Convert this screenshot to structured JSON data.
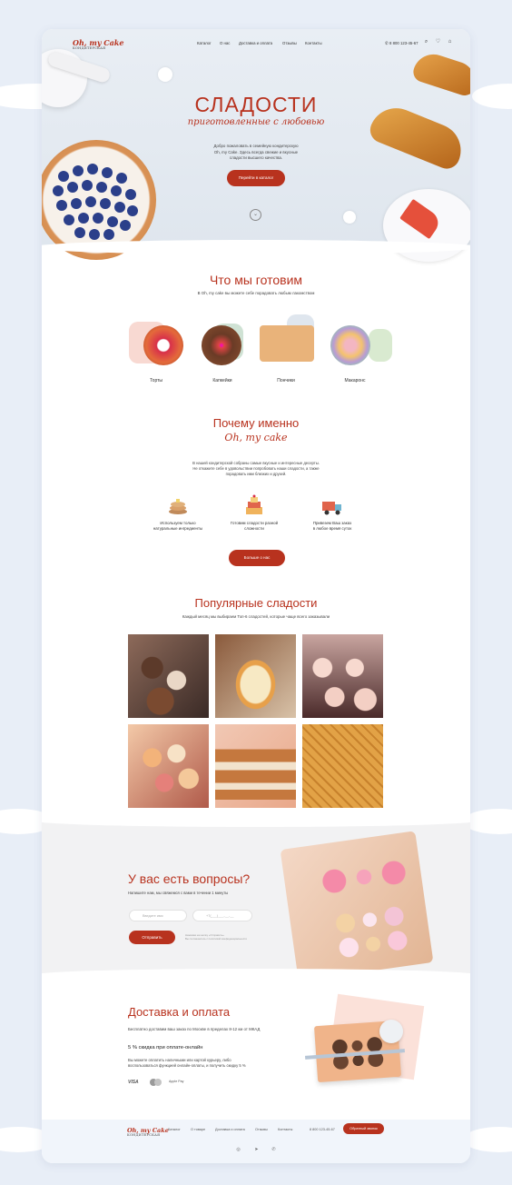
{
  "brand": {
    "logo": "Oh, my Cake",
    "tagline": "КОНДИТЕРСКАЯ"
  },
  "nav": {
    "items": [
      "Каталог",
      "О нас",
      "Доставка и оплата",
      "Отзывы",
      "Контакты"
    ],
    "phone": "8 800 123-45-67"
  },
  "hero": {
    "title": "СЛАДОСТИ",
    "script": "приготовленные с любовью",
    "text_lines": [
      "Добро пожаловать в семейную кондитерскую",
      "Oh, my Cake. Здесь всегда свежие и вкусные",
      "сладости высшего качества."
    ],
    "button": "Перейти в каталог"
  },
  "what": {
    "title": "Что мы готовим",
    "subtitle": "В Oh, my cake вы можете себе порадовать любым лакомством",
    "items": [
      "Торты",
      "Капкейки",
      "Пончики",
      "Макаронс"
    ]
  },
  "why": {
    "title": "Почему именно",
    "script": "Oh, my cake",
    "text_lines": [
      "В нашей кондитерской собраны самые вкусные и интересные десерты.",
      "Не откажите себе в удовольствии попробовать наши сладости, а также",
      "порадовать ими близких и друзей."
    ],
    "features": [
      {
        "l1": "Используем только",
        "l2": "натуральные ингредиенты"
      },
      {
        "l1": "Готовим сладости разной",
        "l2": "сложности"
      },
      {
        "l1": "Привезем Ваш заказ",
        "l2": "в любое время суток"
      }
    ],
    "button": "Больше о нас"
  },
  "popular": {
    "title": "Популярные сладости",
    "subtitle": "Каждый месяц мы выбираем Топ-6 сладостей, которые чаще всего заказывали"
  },
  "questions": {
    "title": "У вас есть вопросы?",
    "subtitle": "Напишите нам, мы свяжемся с вами в течении 1 минуты",
    "name_placeholder": "Введите имя",
    "phone_placeholder": "+7(___)___-__-__",
    "button": "Отправить",
    "consent_l1": "Нажимая на кнопку «Отправить»",
    "consent_l2": "Вы соглашаетесь с политикой конфиденциальности"
  },
  "delivery": {
    "title": "Доставка и оплата",
    "text": "Бесплатно доставим ваш заказ по Москве в пределах 8-12 км от МКАД",
    "discount": "5 % скидка при оплате-онлайн",
    "text2_l1": "Вы можете оплатить наличными или картой курьеру, либо",
    "text2_l2": "воспользоваться функцией онлайн-оплаты, и получить скидку 5 %",
    "pay": [
      "VISA",
      "mastercard",
      "Apple Pay"
    ]
  },
  "footer": {
    "items": [
      "Каталог",
      "О товаре",
      "Доставка и оплата",
      "Отзывы",
      "Контакты"
    ],
    "phone": "8 800 123-45-67",
    "button": "Обратный звонок"
  },
  "colors": {
    "accent": "#b8321e",
    "page_bg": "#e8eef7"
  }
}
